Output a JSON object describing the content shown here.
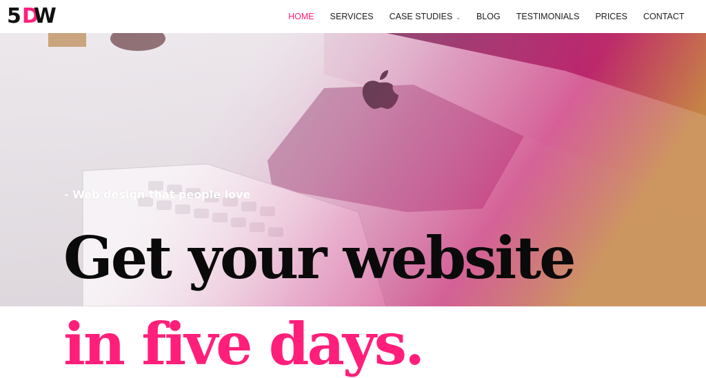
{
  "logo": {
    "part1": "5",
    "part2": "D",
    "part3": "W"
  },
  "nav": {
    "items": [
      {
        "label": "HOME",
        "active": true
      },
      {
        "label": "SERVICES",
        "active": false
      },
      {
        "label": "CASE STUDIES",
        "active": false,
        "dropdown": true
      },
      {
        "label": "BLOG",
        "active": false
      },
      {
        "label": "TESTIMONIALS",
        "active": false
      },
      {
        "label": "PRICES",
        "active": false
      },
      {
        "label": "CONTACT",
        "active": false
      }
    ],
    "dropdown_icon": "chevron-down-icon"
  },
  "hero": {
    "tagline": "- Web design that people love",
    "headline_line1": "Get your website",
    "headline_line2": "in five days.",
    "background_icon": "apple-logo-icon"
  },
  "colors": {
    "accent": "#ff1f7a",
    "text_dark": "#0a0a0a",
    "nav_text": "#1c1c1c",
    "hero_gradient_end": "#c4206a"
  }
}
